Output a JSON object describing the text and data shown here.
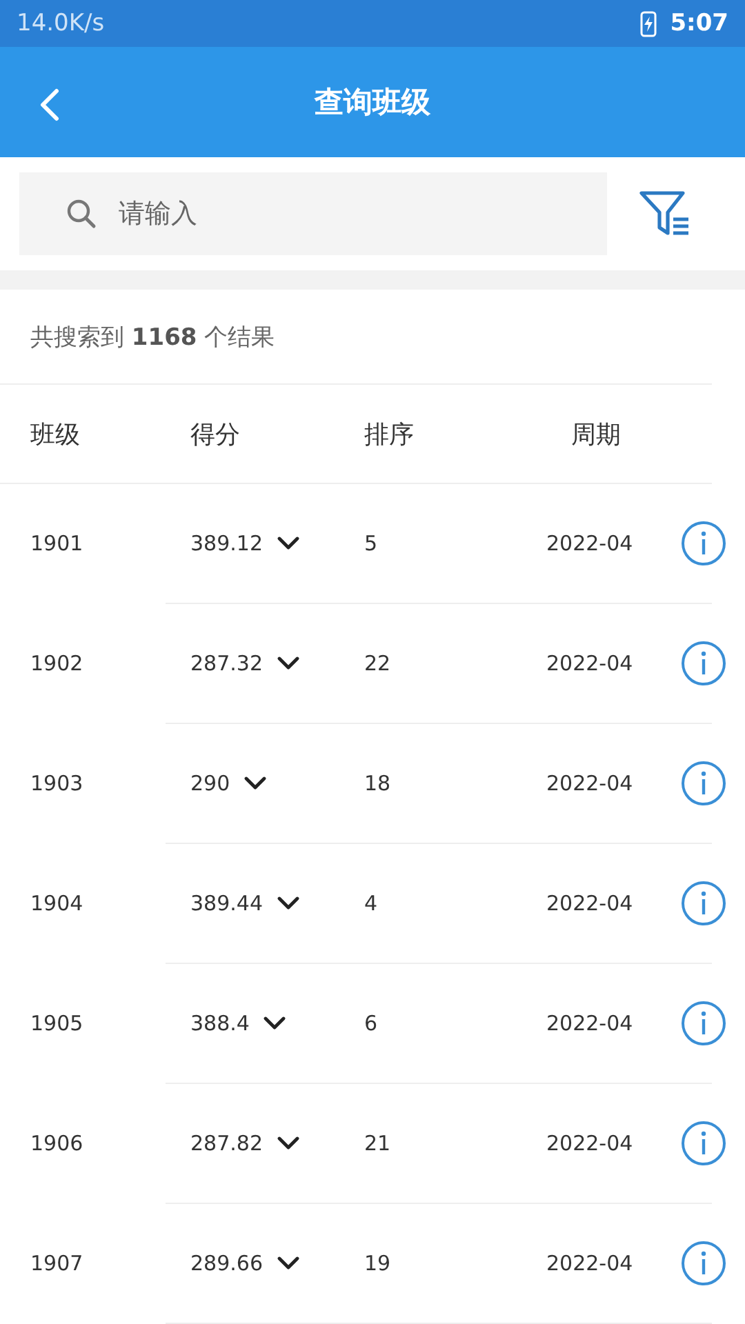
{
  "status_bar": {
    "speed": "14.0K/s",
    "time": "5:07"
  },
  "app_bar": {
    "title": "查询班级"
  },
  "search": {
    "placeholder": "请输入"
  },
  "result_count": "共搜索到 **1168** 个结果",
  "table": {
    "columns": [
      "班级",
      "得分",
      "排序",
      "周期"
    ],
    "rows": [
      {
        "class": "1901",
        "score": "389.12",
        "rank": "5",
        "period": "2022-04"
      },
      {
        "class": "1902",
        "score": "287.32",
        "rank": "22",
        "period": "2022-04"
      },
      {
        "class": "1903",
        "score": "290",
        "rank": "18",
        "period": "2022-04"
      },
      {
        "class": "1904",
        "score": "389.44",
        "rank": "4",
        "period": "2022-04"
      },
      {
        "class": "1905",
        "score": "388.4",
        "rank": "6",
        "period": "2022-04"
      },
      {
        "class": "1906",
        "score": "287.82",
        "rank": "21",
        "period": "2022-04"
      },
      {
        "class": "1907",
        "score": "289.66",
        "rank": "19",
        "period": "2022-04"
      }
    ]
  }
}
